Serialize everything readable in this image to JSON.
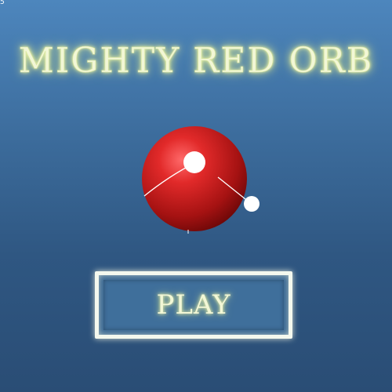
{
  "game": {
    "title": "MIGHTY RED ORB",
    "play_label": "PLAY",
    "corner_mark": "5"
  },
  "colors": {
    "background_top": "#4d86bd",
    "background_bottom": "#2a4d75",
    "orb": "#c01818",
    "orb_highlight": "#ff5a5a",
    "title_glow": "#f2f7d6",
    "satellite": "#ffffff"
  }
}
